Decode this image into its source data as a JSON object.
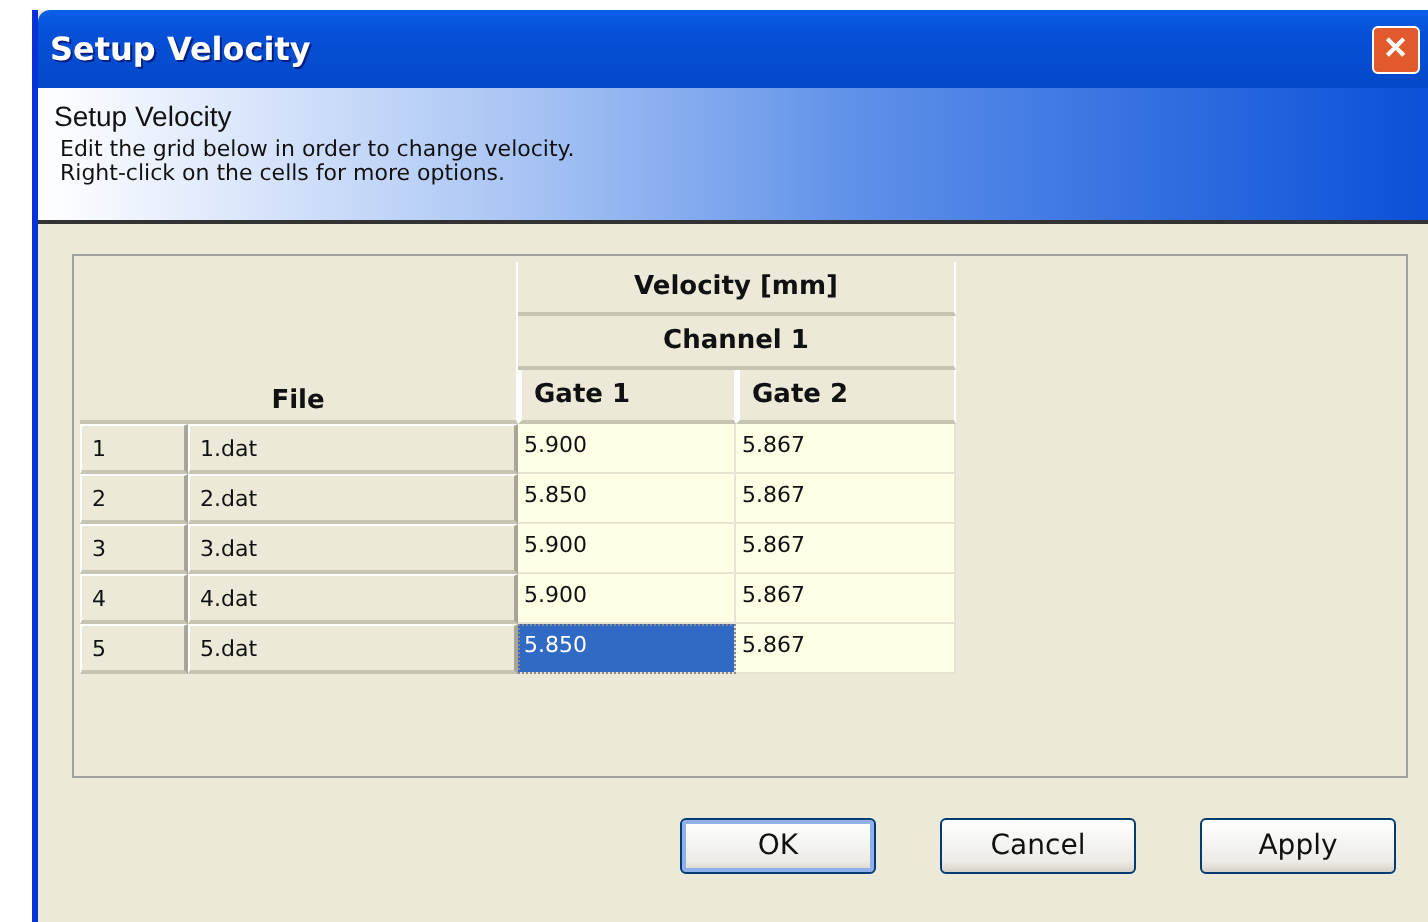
{
  "window": {
    "title": "Setup Velocity",
    "close": "✕"
  },
  "header": {
    "title": "Setup Velocity",
    "lines": [
      "Edit the grid below in order to change velocity.",
      "Right-click on the cells for more options."
    ]
  },
  "grid": {
    "group_header": "Velocity [mm]",
    "channel_header": "Channel 1",
    "file_header": "File",
    "gate_headers": [
      "Gate 1",
      "Gate 2"
    ],
    "rows": [
      {
        "index": "1",
        "file": "1.dat",
        "values": [
          {
            "text": "5.900",
            "selected": false
          },
          {
            "text": "5.867",
            "selected": false
          }
        ]
      },
      {
        "index": "2",
        "file": "2.dat",
        "values": [
          {
            "text": "5.850",
            "selected": false
          },
          {
            "text": "5.867",
            "selected": false
          }
        ]
      },
      {
        "index": "3",
        "file": "3.dat",
        "values": [
          {
            "text": "5.900",
            "selected": false
          },
          {
            "text": "5.867",
            "selected": false
          }
        ]
      },
      {
        "index": "4",
        "file": "4.dat",
        "values": [
          {
            "text": "5.900",
            "selected": false
          },
          {
            "text": "5.867",
            "selected": false
          }
        ]
      },
      {
        "index": "5",
        "file": "5.dat",
        "values": [
          {
            "text": "5.850",
            "selected": true
          },
          {
            "text": "5.867",
            "selected": false
          }
        ]
      }
    ]
  },
  "buttons": [
    {
      "label": "OK",
      "default": true
    },
    {
      "label": "Cancel",
      "default": false
    },
    {
      "label": "Apply",
      "default": false
    }
  ]
}
